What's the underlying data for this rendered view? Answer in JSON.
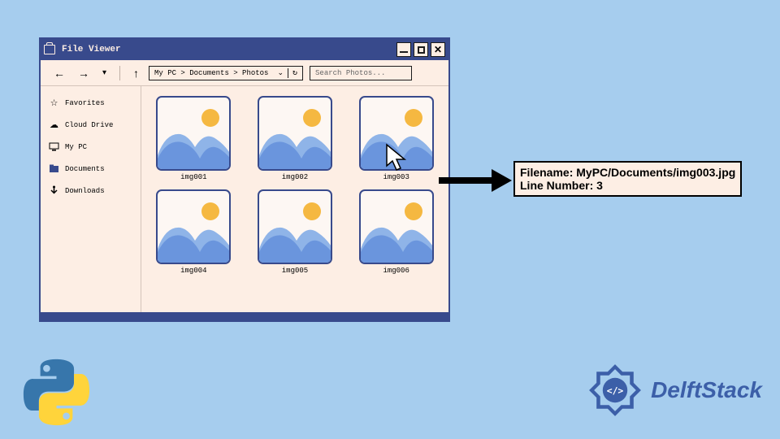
{
  "window": {
    "title": "File Viewer"
  },
  "toolbar": {
    "breadcrumb": "My PC > Documents > Photos",
    "search_placeholder": "Search Photos..."
  },
  "sidebar": {
    "items": [
      {
        "icon": "star",
        "label": "Favorites"
      },
      {
        "icon": "cloud",
        "label": "Cloud Drive"
      },
      {
        "icon": "pc",
        "label": "My PC"
      },
      {
        "icon": "doc",
        "label": "Documents"
      },
      {
        "icon": "download",
        "label": "Downloads"
      }
    ]
  },
  "files": [
    {
      "label": "img001"
    },
    {
      "label": "img002"
    },
    {
      "label": "img003"
    },
    {
      "label": "img004"
    },
    {
      "label": "img005"
    },
    {
      "label": "img006"
    }
  ],
  "tooltip": {
    "line1_label": "Filename:",
    "line1_value": "MyPC/Documents/img003.jpg",
    "line2_label": "Line Number:",
    "line2_value": "3"
  },
  "brand": {
    "name": "DelftStack"
  }
}
